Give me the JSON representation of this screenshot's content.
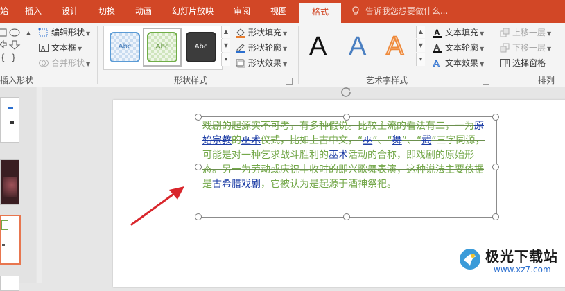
{
  "tabs": [
    {
      "label": "始",
      "active": false
    },
    {
      "label": "插入",
      "active": false
    },
    {
      "label": "设计",
      "active": false
    },
    {
      "label": "切换",
      "active": false
    },
    {
      "label": "动画",
      "active": false
    },
    {
      "label": "幻灯片放映",
      "active": false
    },
    {
      "label": "审阅",
      "active": false
    },
    {
      "label": "视图",
      "active": false
    },
    {
      "label": "格式",
      "active": true
    }
  ],
  "tell_me": "告诉我您想要做什么...",
  "ribbon": {
    "insert_shapes": {
      "label": "插入形状",
      "edit_shape": "编辑形状",
      "text_box": "文本框",
      "merge_shapes": "合并形状"
    },
    "shape_styles": {
      "label": "形状样式",
      "swatch_text": "Abc",
      "fill": "形状填充",
      "outline": "形状轮廓",
      "effects": "形状效果"
    },
    "wordart": {
      "label": "艺术字样式",
      "sample": "A",
      "text_fill": "文本填充",
      "text_outline": "文本轮廓",
      "text_effects": "文本效果"
    },
    "arrange": {
      "label": "排列",
      "bring_forward": "上移一层",
      "send_backward": "下移一层",
      "selection_pane": "选择窗格"
    }
  },
  "textbox": {
    "seg1": "戏剧的起源实不可考，有多种假说。比较主流的看法有二，一为",
    "link1": "原始宗教",
    "seg2": "的",
    "link2": "巫术",
    "seg3": "仪式，比如上古中文，“",
    "link3": "巫",
    "seg4": "”、“",
    "link4": "舞",
    "seg5": "”、“",
    "link5": "武",
    "seg6": "”三字同源，可能是对一种乞求战斗胜利的",
    "link6": "巫术",
    "seg7": "活动的合称，即戏剧的原始形态。另一为劳动或庆祝丰收时的即兴歌舞表演，这种说法主要依据是",
    "link7": "古希腊戏剧",
    "seg8": "，它被认为是起源于酒神祭祀。"
  },
  "watermark": {
    "name": "极光下载站",
    "url": "www.xz7.com"
  },
  "colors": {
    "accent": "#d24726",
    "text_green": "#74a84a",
    "link_blue": "#1f3fa6",
    "arrow_red": "#d9262c"
  }
}
